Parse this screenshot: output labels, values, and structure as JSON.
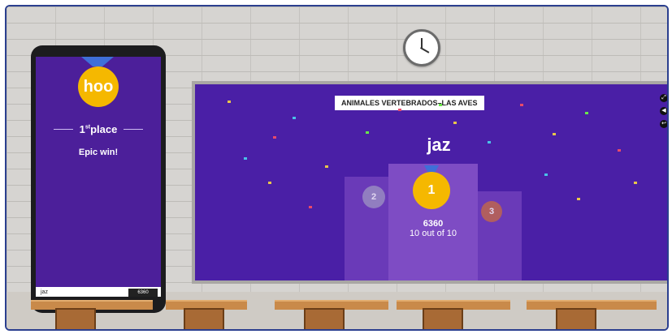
{
  "phone": {
    "logo_text": "hoo",
    "place_number": "1",
    "place_suffix": "st",
    "place_word": "place",
    "message": "Epic win!",
    "player_name": "jaz",
    "score": "6360"
  },
  "board": {
    "quiz_title": "ANIMALES VERTEBRADOS–LAS AVES",
    "winner_name": "jaz",
    "first_medal": "1",
    "second_medal": "2",
    "third_medal": "3",
    "points": "6360",
    "correct": "10 out of 10"
  },
  "colors": {
    "board_bg": "#4a1fa6",
    "medal_gold": "#f5b800",
    "phone_bg": "#4c1f9a"
  }
}
